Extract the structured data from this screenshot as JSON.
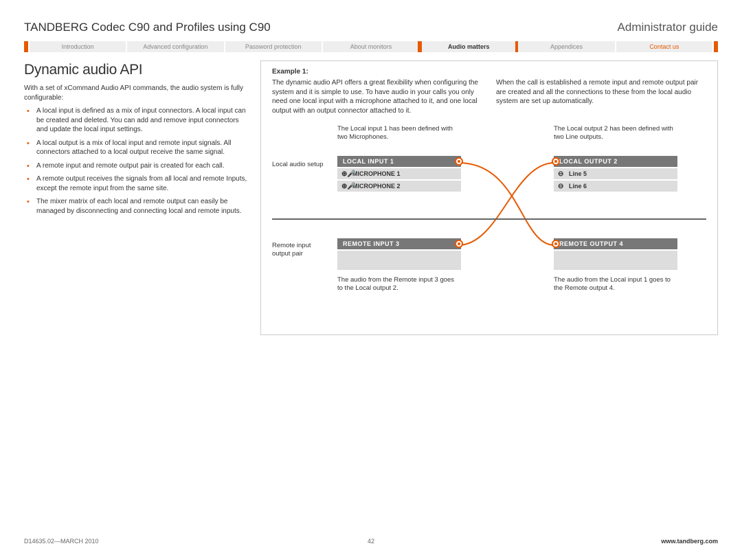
{
  "header": {
    "title_left": "TANDBERG Codec C90 and Profiles using C90",
    "title_right": "Administrator guide"
  },
  "nav": {
    "items": [
      {
        "label": "Introduction"
      },
      {
        "label": "Advanced configuration"
      },
      {
        "label": "Password protection"
      },
      {
        "label": "About monitors"
      },
      {
        "label": "Audio matters",
        "active": true
      },
      {
        "label": "Appendices"
      },
      {
        "label": "Contact us",
        "contact": true
      }
    ]
  },
  "main": {
    "heading": "Dynamic audio API",
    "intro": "With a set of xCommand Audio API commands, the audio system is fully configurable:",
    "bullets": [
      "A local input is defined as a mix of input connectors. A local input can be created and deleted. You can add and remove input connectors and update the local input settings.",
      "A local output is a mix of local input and remote input signals. All connectors attached to a local output receive the same signal.",
      "A remote input and remote output pair is created for each call.",
      "A remote output receives the signals from all local and remote Inputs, except the remote input from the same site.",
      "The mixer matrix of each local and remote output can easily be managed by disconnecting and connecting local and remote inputs."
    ]
  },
  "example": {
    "title": "Example 1:",
    "para_left": "The dynamic audio API offers a great flexibility when configuring the system and it is simple to use. To have audio in your calls you only need one local input with a microphone attached to it, and one local output with an output connector attached to it.",
    "para_right": "When the call is established a remote input and remote output pair are created and all the connections to these from the local audio system are set up automatically.",
    "diagram": {
      "local_input_caption": "The Local input 1 has been defined with two Microphones.",
      "local_output_caption": "The Local output 2 has been defined with two Line outputs.",
      "side_label_top": "Local audio setup",
      "side_label_bottom": "Remote input output pair",
      "local_input_title": "LOCAL INPUT 1",
      "mic1": "MICROPHONE 1",
      "mic2": "MICROPHONE 2",
      "local_output_title": "LOCAL OUTPUT 2",
      "line5": "Line 5",
      "line6": "Line 6",
      "remote_input_title": "REMOTE INPUT 3",
      "remote_output_title": "REMOTE OUTPUT 4",
      "remote_in_caption": "The audio from the Remote input 3 goes to the Local output 2.",
      "remote_out_caption": "The audio from the Local input 1 goes to the Remote output 4."
    }
  },
  "footer": {
    "left": "D14635.02—MARCH 2010",
    "center": "42",
    "right": "www.tandberg.com"
  }
}
